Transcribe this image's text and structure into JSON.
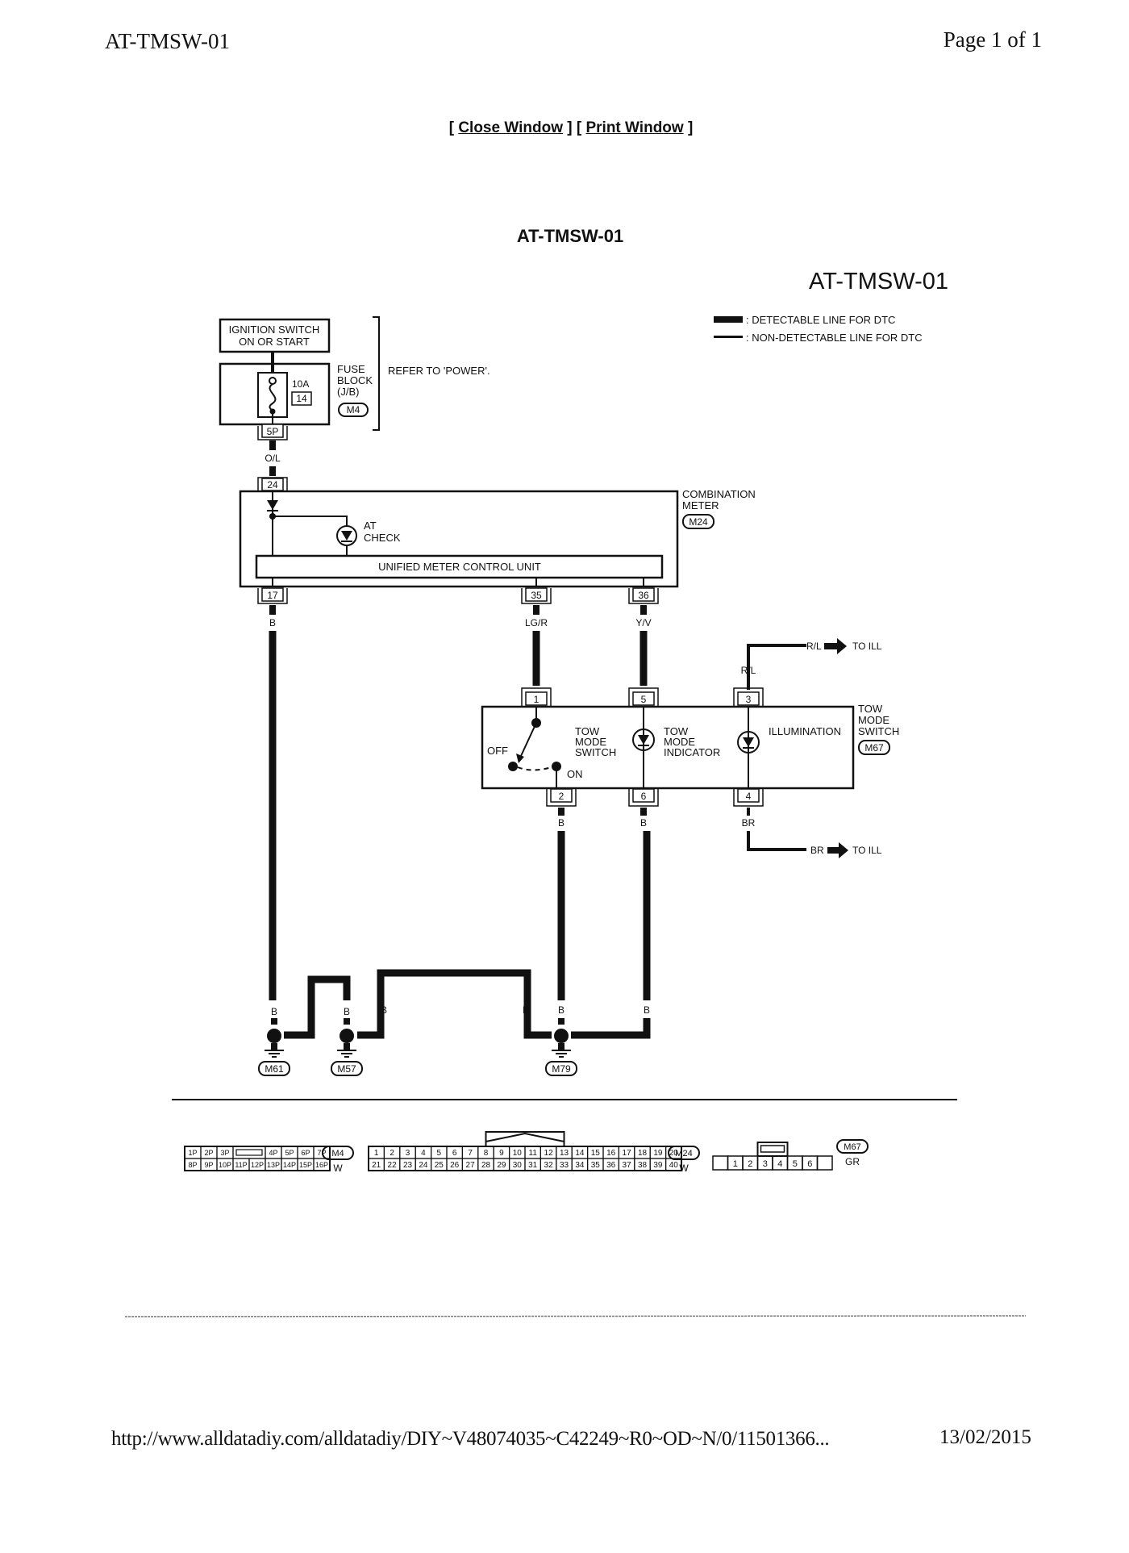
{
  "header": {
    "doc_id": "AT-TMSW-01",
    "page_indicator": "Page 1 of 1"
  },
  "nav": {
    "open_bracket": "[ ",
    "close_window": "Close Window",
    "separator": " ] [ ",
    "print_window": "Print Window",
    "close_bracket": " ]"
  },
  "document": {
    "title": "AT-TMSW-01"
  },
  "diagram": {
    "code": "AT-TMSW-01",
    "legend": [
      {
        "label": ": DETECTABLE LINE FOR DTC"
      },
      {
        "label": ": NON-DETECTABLE LINE FOR DTC"
      }
    ],
    "ignition": {
      "line1": "IGNITION SWITCH",
      "line2": "ON OR START"
    },
    "fuse_block": {
      "rating": "10A",
      "fuse_no": "14",
      "label1": "FUSE",
      "label2": "BLOCK",
      "label3": "(J/B)",
      "connector": "M4",
      "pin": "5P",
      "refer": "REFER TO 'POWER'."
    },
    "wire_ol": "O/L",
    "combination_meter": {
      "label1": "COMBINATION",
      "label2": "METER",
      "connector": "M24",
      "pin_in": "24",
      "lamp_line1": "AT",
      "lamp_line2": "CHECK",
      "control_unit": "UNIFIED METER CONTROL UNIT",
      "pins_out": [
        "17",
        "35",
        "36"
      ],
      "wires_out": [
        "B",
        "LG/R",
        "Y/V"
      ]
    },
    "tow_mode_switch": {
      "label1": "TOW",
      "label2": "MODE",
      "label3": "SWITCH",
      "connector": "M67",
      "pins_top": [
        "1",
        "5",
        "3"
      ],
      "pins_bottom": [
        "2",
        "6",
        "4"
      ],
      "switch_label": [
        "TOW",
        "MODE",
        "SWITCH"
      ],
      "indicator_label": [
        "TOW",
        "MODE",
        "INDICATOR"
      ],
      "illumination_label": "ILLUMINATION",
      "off_label": "OFF",
      "on_label": "ON",
      "wire_rl": "R/L",
      "wire_br": "BR",
      "wires_bottom": [
        "B",
        "B"
      ],
      "to_ill_top": {
        "wire": "R/L",
        "dest": "TO ILL"
      },
      "to_ill_bottom": {
        "wire": "BR",
        "dest": "TO ILL"
      }
    },
    "ground_wires": [
      "B",
      "B",
      "B",
      "B",
      "B",
      "B",
      "B"
    ],
    "grounds": [
      "M61",
      "M57",
      "M79"
    ]
  },
  "connectors": {
    "m4": {
      "id": "M4",
      "color": "W",
      "row1": [
        "1P",
        "2P",
        "3P",
        "",
        "4P",
        "5P",
        "6P",
        "7P"
      ],
      "row2": [
        "8P",
        "9P",
        "10P",
        "11P",
        "12P",
        "13P",
        "14P",
        "15P",
        "16P"
      ]
    },
    "m24": {
      "id": "M24",
      "color": "W",
      "row1": [
        "1",
        "2",
        "3",
        "4",
        "5",
        "6",
        "7",
        "8",
        "9",
        "10",
        "11",
        "12",
        "13",
        "14",
        "15",
        "16",
        "17",
        "18",
        "19",
        "20"
      ],
      "row2": [
        "21",
        "22",
        "23",
        "24",
        "25",
        "26",
        "27",
        "28",
        "29",
        "30",
        "31",
        "32",
        "33",
        "34",
        "35",
        "36",
        "37",
        "38",
        "39",
        "40"
      ]
    },
    "m67": {
      "id": "M67",
      "color": "GR",
      "pins": [
        "",
        "1",
        "2",
        "3",
        "4",
        "5",
        "6",
        ""
      ]
    }
  },
  "footer": {
    "url": "http://www.alldatadiy.com/alldatadiy/DIY~V48074035~C42249~R0~OD~N/0/11501366...",
    "date": "13/02/2015"
  }
}
